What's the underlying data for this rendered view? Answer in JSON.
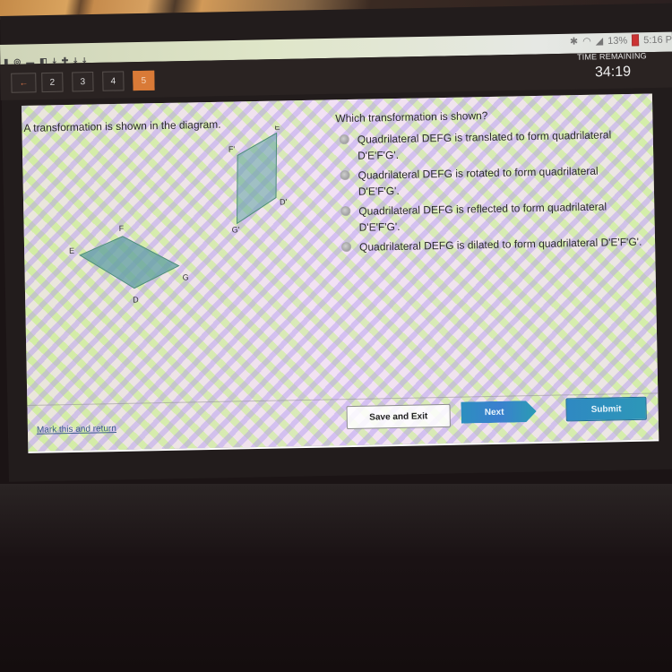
{
  "status_bar": {
    "left_icons": [
      "usb-icon",
      "app-icon",
      "video-icon",
      "flag-icon",
      "download-icon",
      "circle-icon",
      "download-icon",
      "download-icon"
    ],
    "right_icons": [
      "bluetooth-icon",
      "wifi-icon",
      "signal-icon"
    ],
    "battery_percent": "13%",
    "time": "5:16 P"
  },
  "nav": {
    "back_label": "←",
    "questions": [
      {
        "label": "2",
        "active": false
      },
      {
        "label": "3",
        "active": false
      },
      {
        "label": "4",
        "active": false
      },
      {
        "label": "5",
        "active": true
      }
    ]
  },
  "timer": {
    "label": "TIME REMAINING",
    "value": "34:19"
  },
  "question": {
    "left_prompt": "A transformation is shown in the diagram.",
    "right_prompt": "Which transformation is shown?",
    "diagram": {
      "original_labels": {
        "D": "D",
        "E": "E",
        "F": "F",
        "G": "G"
      },
      "image_labels": {
        "D": "D'",
        "E": "E'",
        "F": "F'",
        "G": "G'"
      },
      "fill_color": "#5e9fa0",
      "stroke_color": "#4f8f7a"
    },
    "choices": [
      {
        "text": "Quadrilateral DEFG is translated to form quadrilateral D'E'F'G'."
      },
      {
        "text": "Quadrilateral DEFG is rotated to form quadrilateral D'E'F'G'."
      },
      {
        "text": "Quadrilateral DEFG is reflected to form quadrilateral D'E'F'G'."
      },
      {
        "text": "Quadrilateral DEFG is dilated to form quadrilateral D'E'F'G'."
      }
    ]
  },
  "footer": {
    "mark_link": "Mark this and return",
    "save_exit": "Save and Exit",
    "next": "Next",
    "submit": "Submit"
  },
  "colors": {
    "active_question": "#d97a37",
    "primary_button": "#2f89c2"
  }
}
